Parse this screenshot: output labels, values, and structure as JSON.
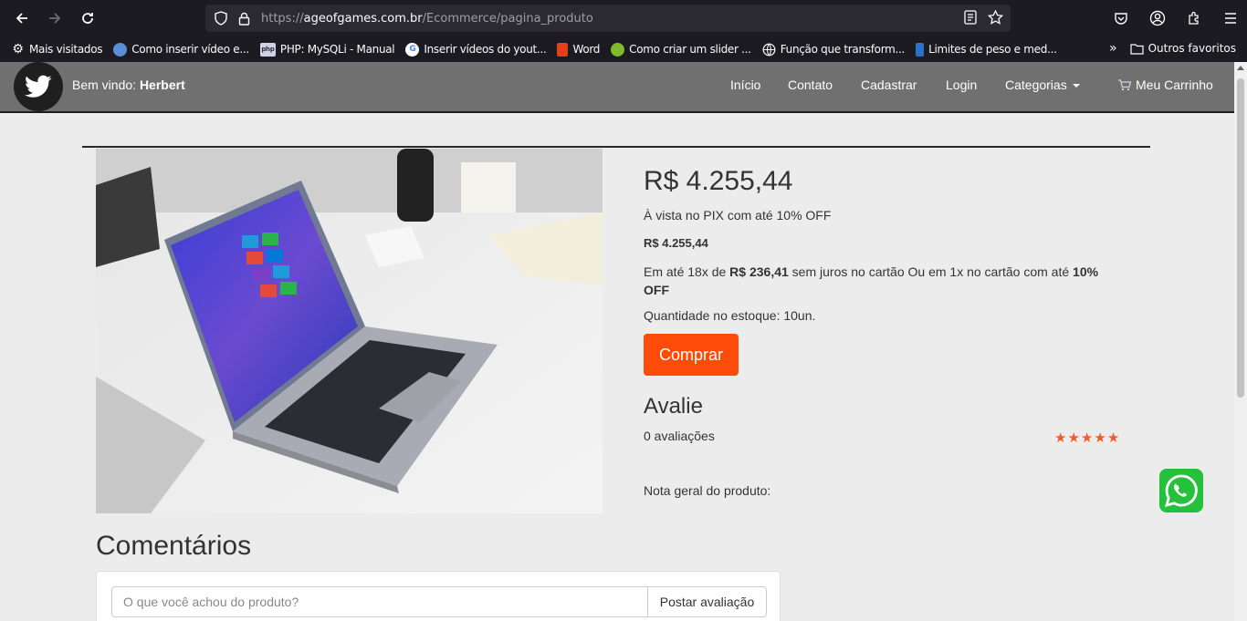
{
  "browser": {
    "url_prefix": "https://",
    "url_domain": "ageofgames.com.br",
    "url_path": "/Ecommerce/pagina_produto",
    "bookmarks": [
      {
        "label": "Mais visitados",
        "icon": "gear-icon"
      },
      {
        "label": "Como inserir vídeo e...",
        "icon": "globe-favicon"
      },
      {
        "label": "PHP: MySQLi - Manual",
        "icon": "php-favicon"
      },
      {
        "label": "Inserir vídeos do yout...",
        "icon": "google-favicon"
      },
      {
        "label": "Word",
        "icon": "office-favicon"
      },
      {
        "label": "Como criar um slider ...",
        "icon": "green-favicon"
      },
      {
        "label": "Função que transform...",
        "icon": "globe-icon"
      },
      {
        "label": "Limites de peso e med...",
        "icon": "bookmark-favicon"
      }
    ],
    "other_bookmarks": "Outros favoritos"
  },
  "header": {
    "welcome_prefix": "Bem vindo:",
    "username": "Herbert",
    "nav": [
      "Início",
      "Contato",
      "Cadastrar",
      "Login",
      "Categorias"
    ],
    "cart": "Meu Carrinho"
  },
  "product": {
    "price": "R$ 4.255,44",
    "pix_text": "À vista no PIX com até 10% OFF",
    "price_small": "R$ 4.255,44",
    "installment_a": "Em até 18x de ",
    "installment_value": "R$ 236,41",
    "installment_b": " sem juros no cartão Ou em 1x no cartão com até ",
    "installment_discount": "10% OFF",
    "stock": "Quantidade no estoque: 10un.",
    "buy_label": "Comprar",
    "rate_title": "Avalie",
    "reviews_count": "0 avaliações",
    "rating": 5,
    "overall_label": "Nota geral do produto:"
  },
  "comments": {
    "title": "Comentários",
    "placeholder": "O que você achou do produto?",
    "post_label": "Postar avaliação"
  },
  "colors": {
    "buy_button": "#fd4b0a",
    "header_bg": "#6f706f",
    "star": "#f25c2a",
    "whatsapp": "#25c13d"
  }
}
